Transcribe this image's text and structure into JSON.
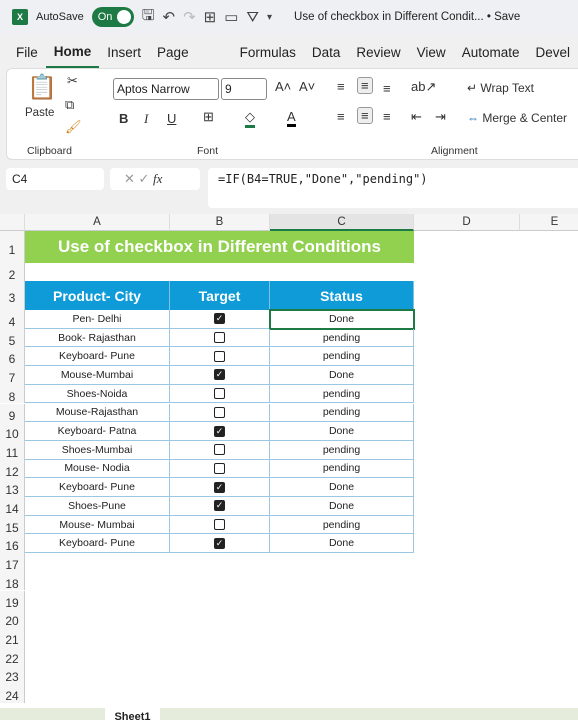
{
  "titlebar": {
    "autosave_label": "AutoSave",
    "autosave_state": "On",
    "document_title": "Use of checkbox in Different Condit... • Save"
  },
  "tabs": [
    "File",
    "Home",
    "Insert",
    "Page Layout",
    "Formulas",
    "Data",
    "Review",
    "View",
    "Automate",
    "Devel"
  ],
  "active_tab": "Home",
  "ribbon": {
    "paste": "Paste",
    "clipboard": "Clipboard",
    "font_name": "Aptos Narrow",
    "font_size": "9",
    "font": "Font",
    "bold": "B",
    "italic": "I",
    "underline": "U",
    "wrap_text": "Wrap Text",
    "merge_center": "Merge & Center",
    "alignment": "Alignment"
  },
  "formula_bar": {
    "name_box": "C4",
    "fx": "fx",
    "formula": "=IF(B4=TRUE,\"Done\",\"pending\")"
  },
  "columns": [
    "A",
    "B",
    "C",
    "D",
    "E"
  ],
  "rows": [
    "1",
    "2",
    "3",
    "4",
    "5",
    "6",
    "7",
    "8",
    "9",
    "10",
    "11",
    "12",
    "13",
    "14",
    "15",
    "16",
    "17",
    "18",
    "19",
    "20",
    "21",
    "22",
    "23",
    "24"
  ],
  "sheet": {
    "title": "Use of checkbox in Different Conditions",
    "headers": [
      "Product- City",
      "Target",
      "Status"
    ],
    "data": [
      {
        "product": "Pen- Delhi",
        "target": true,
        "status": "Done"
      },
      {
        "product": "Book- Rajasthan",
        "target": false,
        "status": "pending"
      },
      {
        "product": "Keyboard- Pune",
        "target": false,
        "status": "pending"
      },
      {
        "product": "Mouse-Mumbai",
        "target": true,
        "status": "Done"
      },
      {
        "product": "Shoes-Noida",
        "target": false,
        "status": "pending"
      },
      {
        "product": "Mouse-Rajasthan",
        "target": false,
        "status": "pending"
      },
      {
        "product": "Keyboard- Patna",
        "target": true,
        "status": "Done"
      },
      {
        "product": "Shoes-Mumbai",
        "target": false,
        "status": "pending"
      },
      {
        "product": "Mouse- Nodia",
        "target": false,
        "status": "pending"
      },
      {
        "product": "Keyboard- Pune",
        "target": true,
        "status": "Done"
      },
      {
        "product": "Shoes-Pune",
        "target": true,
        "status": "Done"
      },
      {
        "product": "Mouse- Mumbai",
        "target": false,
        "status": "pending"
      },
      {
        "product": "Keyboard- Pune",
        "target": true,
        "status": "Done"
      }
    ]
  },
  "sheet_tab": "Sheet1",
  "colors": {
    "title_bg": "#92d050",
    "header_bg": "#0e9bd8",
    "excel_green": "#1d7a44"
  }
}
